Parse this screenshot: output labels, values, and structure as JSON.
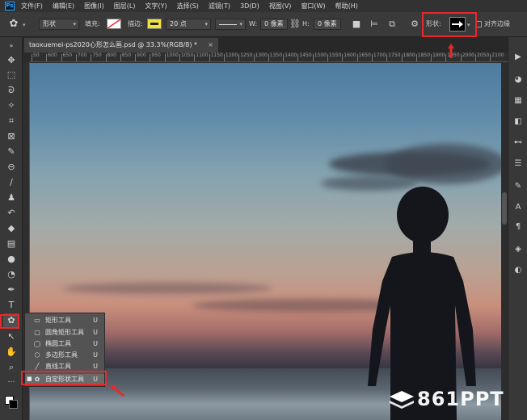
{
  "app": {
    "logo": "Ps"
  },
  "menu": [
    "文件(F)",
    "编辑(E)",
    "图像(I)",
    "图层(L)",
    "文字(Y)",
    "选择(S)",
    "滤镜(T)",
    "3D(D)",
    "视图(V)",
    "窗口(W)",
    "帮助(H)"
  ],
  "options": {
    "mode_value": "形状",
    "fill_label": "填充:",
    "stroke_label": "描边:",
    "stroke_width": "20 点",
    "w_label": "W:",
    "w_value": "0 像素",
    "h_label": "H:",
    "h_value": "0 像素",
    "shape_label": "形状:",
    "align_edges_label": "对齐边缘",
    "stroke_color": "#f2e23c",
    "link_icon": "link-icon"
  },
  "document": {
    "tab_title": "taoxuemei-ps2020心形怎么画.psd @ 33.3%(RGB/8) *",
    "close_glyph": "×"
  },
  "ruler": {
    "ticks": [
      "50",
      "600",
      "650",
      "700",
      "750",
      "800",
      "850",
      "900",
      "950",
      "1000",
      "1050",
      "1100",
      "1150",
      "1200",
      "1250",
      "1300",
      "1350",
      "1400",
      "1450",
      "1500",
      "1550",
      "1600",
      "1650",
      "1700",
      "1750",
      "1800",
      "1850",
      "1900",
      "1950",
      "2000",
      "2050",
      "2100"
    ]
  },
  "flyout": {
    "items": [
      {
        "label": "矩形工具",
        "shortcut": "U"
      },
      {
        "label": "圆角矩形工具",
        "shortcut": "U"
      },
      {
        "label": "椭圆工具",
        "shortcut": "U"
      },
      {
        "label": "多边形工具",
        "shortcut": "U"
      },
      {
        "label": "直线工具",
        "shortcut": "U"
      },
      {
        "label": "自定形状工具",
        "shortcut": "U"
      }
    ]
  },
  "watermark": {
    "text": "861PPT"
  },
  "colors": {
    "annotation": "#e8292b",
    "accent": "#31a8ff"
  }
}
